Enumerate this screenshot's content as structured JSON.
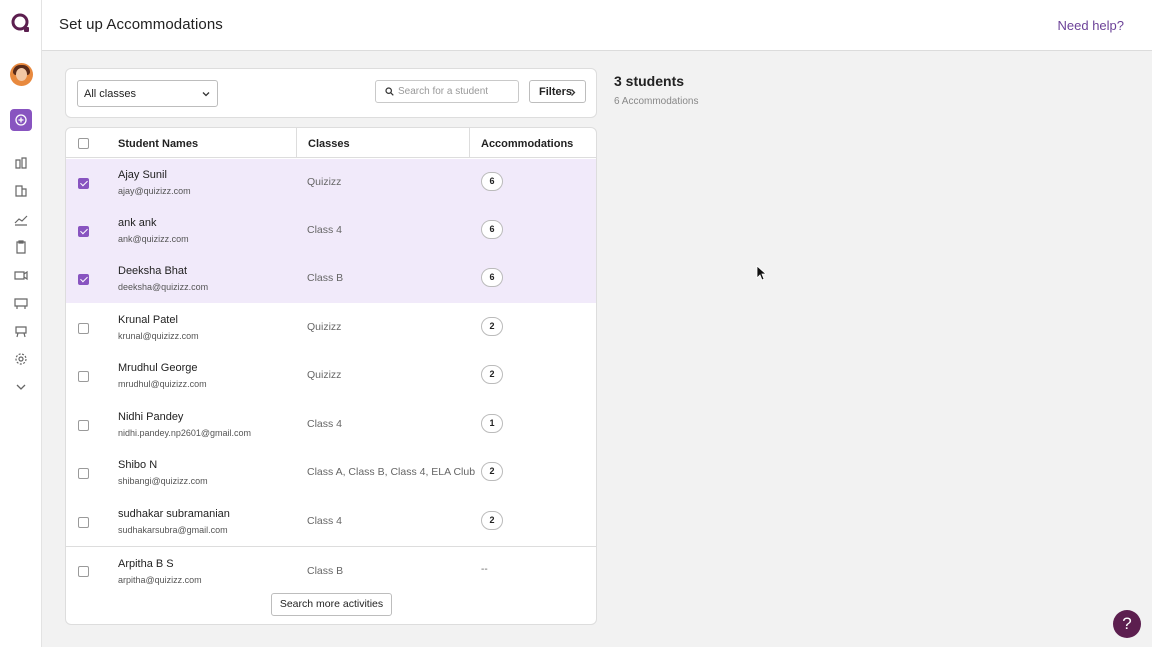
{
  "header": {
    "title": "Set up Accommodations",
    "help_link": "Need help?"
  },
  "sidebar": {
    "icons": [
      "quizizz-logo-icon",
      "avatar",
      "create-plus-icon",
      "library-icon",
      "reports-icon",
      "analytics-icon",
      "clipboard-icon",
      "video-icon",
      "classes-icon",
      "accommodations-icon",
      "settings-icon",
      "chevron-down-icon"
    ]
  },
  "filters": {
    "class_select": "All classes",
    "search_placeholder": "Search for a student",
    "filters_label": "Filters"
  },
  "table": {
    "columns": [
      "Student Names",
      "Classes",
      "Accommodations"
    ],
    "rows": [
      {
        "name": "Ajay Sunil",
        "email": "ajay@quizizz.com",
        "classes": "Quizizz",
        "accommodations": "6",
        "checked": true
      },
      {
        "name": "ank ank",
        "email": "ank@quizizz.com",
        "classes": "Class 4",
        "accommodations": "6",
        "checked": true
      },
      {
        "name": "Deeksha Bhat",
        "email": "deeksha@quizizz.com",
        "classes": "Class B",
        "accommodations": "6",
        "checked": true
      },
      {
        "name": "Krunal Patel",
        "email": "krunal@quizizz.com",
        "classes": "Quizizz",
        "accommodations": "2",
        "checked": false
      },
      {
        "name": "Mrudhul George",
        "email": "mrudhul@quizizz.com",
        "classes": "Quizizz",
        "accommodations": "2",
        "checked": false
      },
      {
        "name": "Nidhi Pandey",
        "email": "nidhi.pandey.np2601@gmail.com",
        "classes": "Class 4",
        "accommodations": "1",
        "checked": false
      },
      {
        "name": "Shibo N",
        "email": "shibangi@quizizz.com",
        "classes": "Class A, Class B, Class 4, ELA Club",
        "accommodations": "2",
        "checked": false
      },
      {
        "name": "sudhakar subramanian",
        "email": "sudhakarsubra@gmail.com",
        "classes": "Class 4",
        "accommodations": "2",
        "checked": false
      },
      {
        "name": "Arpitha B S",
        "email": "arpitha@quizizz.com",
        "classes": "Class B",
        "accommodations": "--",
        "checked": false
      }
    ],
    "more_button": "Search more activities"
  },
  "summary": {
    "title": "3 students",
    "subtitle": "6 Accommodations"
  },
  "help_fab": "?",
  "colors": {
    "accent": "#8854c0",
    "selected_row": "#f1eafa",
    "help_link": "#6c4298",
    "fab": "#5c1f4f"
  }
}
